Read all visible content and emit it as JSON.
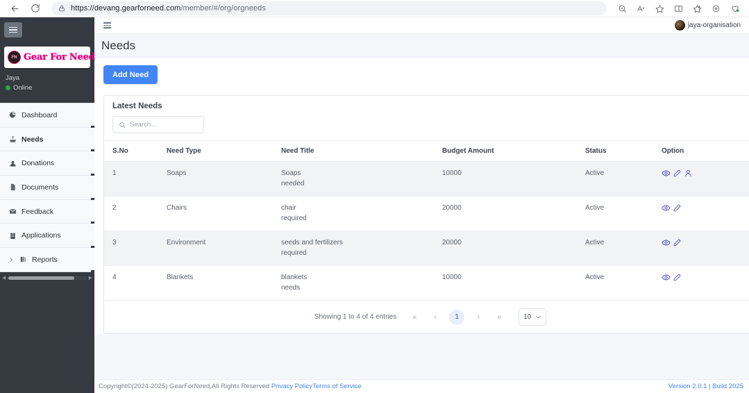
{
  "browser": {
    "url_secure": "https://devang.gearforneed.com",
    "url_path": "/member/#/org/orgneeds",
    "back_icon": "back-arrow-icon",
    "reload_icon": "reload-icon",
    "lock_icon": "lock-icon",
    "toolbar_icons": [
      "zoom-out-icon",
      "read-aloud-icon",
      "favorite-star-icon",
      "split-screen-icon",
      "collections-icon",
      "browser-extensions-icon",
      "copilot-icon"
    ]
  },
  "sidebar": {
    "toggle_label": "menu-toggle",
    "brand": {
      "badge": "FN",
      "name": "Gear For Need"
    },
    "user": {
      "name": "Jaya",
      "status": "Online"
    },
    "items": [
      {
        "label": "Dashboard",
        "icon": "pie-chart-icon",
        "active": false
      },
      {
        "label": "Needs",
        "icon": "hand-heart-icon",
        "active": true
      },
      {
        "label": "Donations",
        "icon": "user-circle-icon",
        "active": false
      },
      {
        "label": "Documents",
        "icon": "file-icon",
        "active": false
      },
      {
        "label": "Feedback",
        "icon": "envelope-icon",
        "active": false
      },
      {
        "label": "Applications",
        "icon": "clipboard-icon",
        "active": false
      },
      {
        "label": "Reports",
        "icon": "books-icon",
        "active": false,
        "expandable": true
      }
    ]
  },
  "topbar": {
    "hamburger": "sidebar-toggle-icon",
    "profile_name": "jaya-organisation"
  },
  "page": {
    "title": "Needs",
    "add_button": "Add Need"
  },
  "card": {
    "title": "Latest Needs",
    "search_placeholder": "Search...",
    "search_value": ""
  },
  "table": {
    "columns": [
      "S.No",
      "Need Type",
      "Need Title",
      "Budget Amount",
      "Status",
      "Option"
    ],
    "rows": [
      {
        "sno": "1",
        "need_type": "Soaps",
        "title_line1": "Soaps",
        "title_line2": "needed",
        "budget": "10000",
        "status": "Active",
        "options": [
          "view-eye-icon",
          "edit-pencil-icon",
          "assign-person-icon"
        ]
      },
      {
        "sno": "2",
        "need_type": "Chairs",
        "title_line1": "chair",
        "title_line2": "required",
        "budget": "20000",
        "status": "Active",
        "options": [
          "view-eye-icon",
          "edit-pencil-icon"
        ]
      },
      {
        "sno": "3",
        "need_type": "Environment",
        "title_line1": "seeds and fertilizers",
        "title_line2": "required",
        "budget": "20000",
        "status": "Active",
        "options": [
          "view-eye-icon",
          "edit-pencil-icon"
        ]
      },
      {
        "sno": "4",
        "need_type": "Blankets",
        "title_line1": "blankets",
        "title_line2": "needs",
        "budget": "10000",
        "status": "Active",
        "options": [
          "view-eye-icon",
          "edit-pencil-icon"
        ]
      }
    ]
  },
  "pagination": {
    "info": "Showing 1 to 4 of 4 entries",
    "first": "«",
    "prev": "‹",
    "current_page": "1",
    "next": "›",
    "last": "»",
    "page_size": "10"
  },
  "footer": {
    "copyright": "Copyright©(2024-2025) GearForNeed,All Rights Reserved",
    "privacy_link": "Privacy Policy",
    "terms_link": "Terms of Service",
    "right_text": "Version 2.0.1 | Build 2025"
  },
  "colors": {
    "accent_blue": "#4285f4",
    "sidebar_dark": "#343a40",
    "brand_pink": "#e4007f",
    "icon_indigo": "#4f52c5",
    "status_green": "#28a745"
  }
}
